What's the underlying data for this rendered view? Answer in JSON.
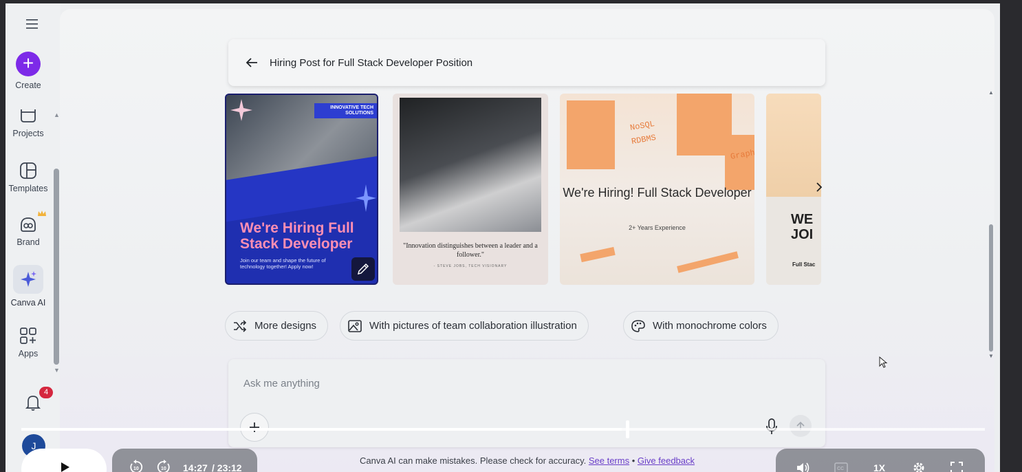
{
  "sidebar": {
    "items": [
      {
        "label": "Create",
        "icon": "plus-icon"
      },
      {
        "label": "Projects",
        "icon": "folder-icon"
      },
      {
        "label": "Templates",
        "icon": "templates-icon"
      },
      {
        "label": "Brand",
        "icon": "brand-icon"
      },
      {
        "label": "Canva AI",
        "icon": "sparkles-icon"
      },
      {
        "label": "Apps",
        "icon": "apps-icon"
      }
    ],
    "notification_count": "4",
    "avatar_initial": "J"
  },
  "header": {
    "title": "Hiring Post for Full Stack Developer Position"
  },
  "cards": [
    {
      "tag": "INNOVATIVE TECH SOLUTIONS",
      "headline": "We're Hiring Full Stack Developer",
      "subtext": "Join our team and shape the future of technology together! Apply now!"
    },
    {
      "quote": "\"Innovation distinguishes between a leader and a follower.\"",
      "author": "- STEVE JOBS, TECH VISIONARY"
    },
    {
      "headline": "We're Hiring! Full Stack Developer",
      "experience": "2+ Years Experience",
      "sign_nosql": "NoSQL",
      "sign_rdbms": "RDBMS",
      "sign_graph": "Graph"
    },
    {
      "headline": "WE JOI",
      "subtext": "Full Stac"
    }
  ],
  "suggestions": [
    {
      "label": "More designs",
      "icon": "shuffle-icon"
    },
    {
      "label": "With pictures of team collaboration illustration",
      "icon": "image-icon"
    },
    {
      "label": "With monochrome colors",
      "icon": "palette-icon"
    }
  ],
  "prompt": {
    "placeholder": "Ask me anything"
  },
  "disclaimer": {
    "text": "Canva AI can make mistakes. Please check for accuracy.",
    "terms_link": "See terms",
    "separator": "•",
    "feedback_link": "Give feedback"
  },
  "player": {
    "current_time": "14:27",
    "total_time": "/ 23:12",
    "progress_fraction": 0.623,
    "speed": "1X",
    "rewind_label": "10",
    "forward_label": "10"
  },
  "colors": {
    "accent": "#7d2ae8",
    "badge": "#d5283f"
  }
}
